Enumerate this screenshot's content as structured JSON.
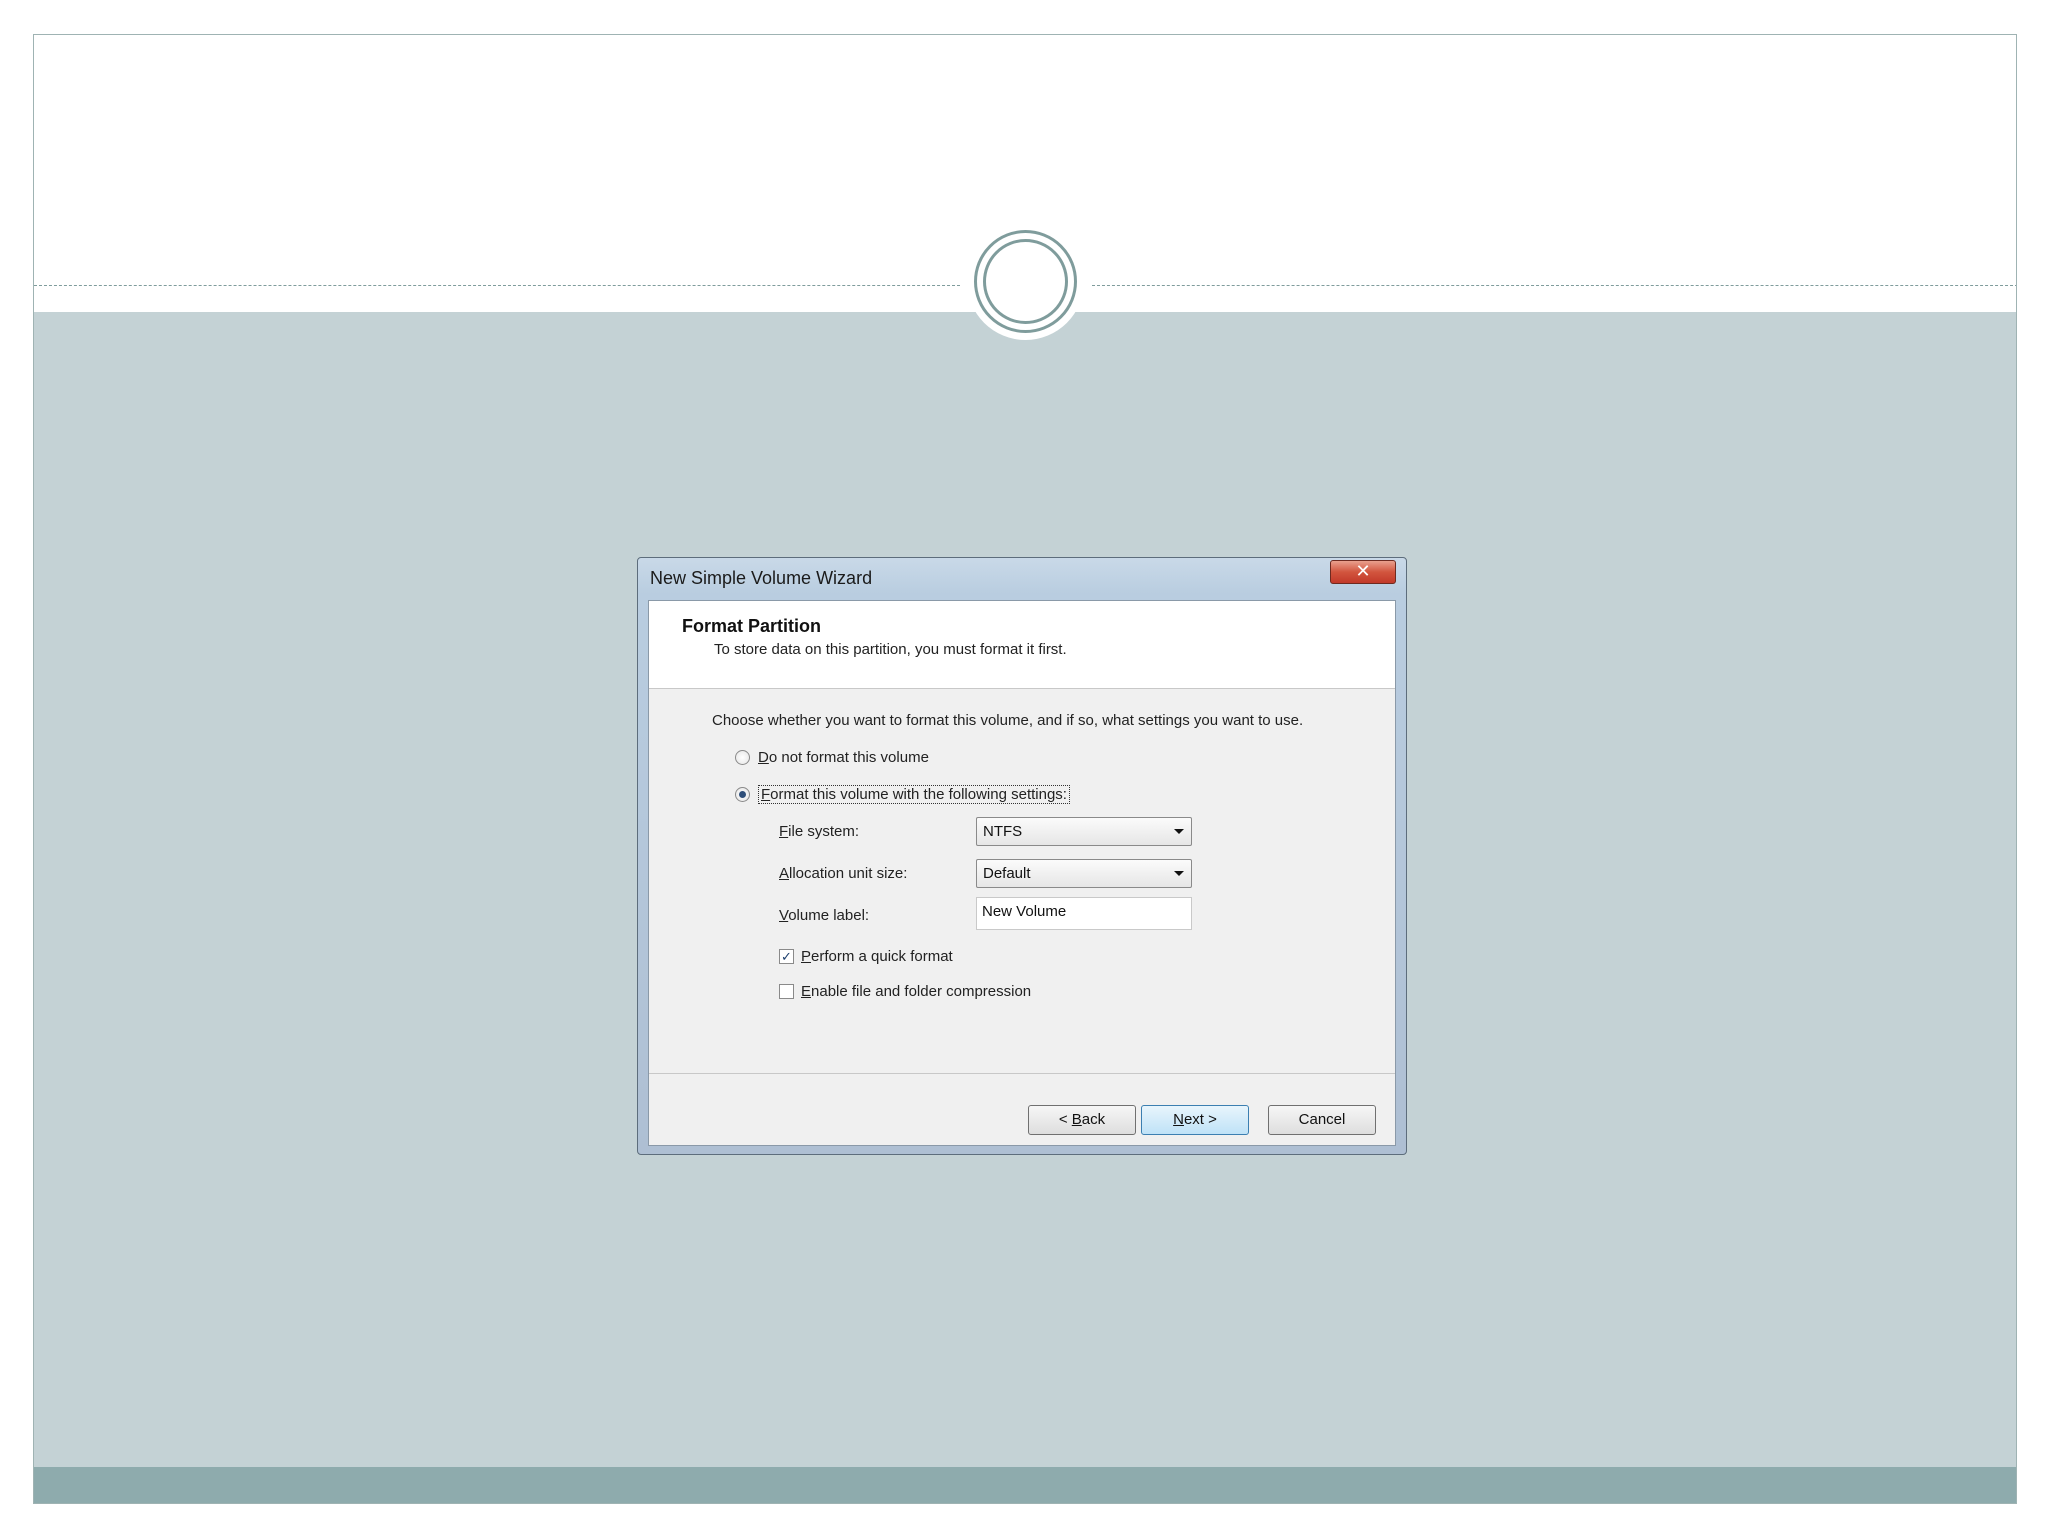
{
  "dialog": {
    "title": "New Simple Volume Wizard",
    "close_glyph": "✕",
    "header": {
      "title": "Format Partition",
      "subtitle": "To store data on this partition, you must format it first."
    },
    "instruction": "Choose whether you want to format this volume, and if so, what settings you want to use.",
    "options": {
      "no_format": {
        "mnemonic": "D",
        "rest": "o not format this volume",
        "selected": false
      },
      "format": {
        "mnemonic": "F",
        "rest": "ormat this volume with the following settings:",
        "selected": true
      }
    },
    "fields": {
      "file_system": {
        "mnemonic": "F",
        "rest": "ile system:",
        "value": "NTFS"
      },
      "allocation_unit_size": {
        "mnemonic": "A",
        "rest": "llocation unit size:",
        "value": "Default"
      },
      "volume_label": {
        "mnemonic": "V",
        "rest": "olume label:",
        "value": "New Volume"
      }
    },
    "checkboxes": {
      "quick_format": {
        "mnemonic": "P",
        "rest": "erform a quick format",
        "checked": true,
        "check_glyph": "✓"
      },
      "compression": {
        "mnemonic": "E",
        "rest": "nable file and folder compression",
        "checked": false
      }
    },
    "buttons": {
      "back": {
        "prefix": "< ",
        "mnemonic": "B",
        "rest": "ack"
      },
      "next": {
        "mnemonic": "N",
        "rest": "ext >"
      },
      "cancel": "Cancel"
    }
  },
  "colors": {
    "slide_background": "#c4d2d5",
    "slide_footer": "#8eabad",
    "accent_line": "#7f9c9c"
  }
}
